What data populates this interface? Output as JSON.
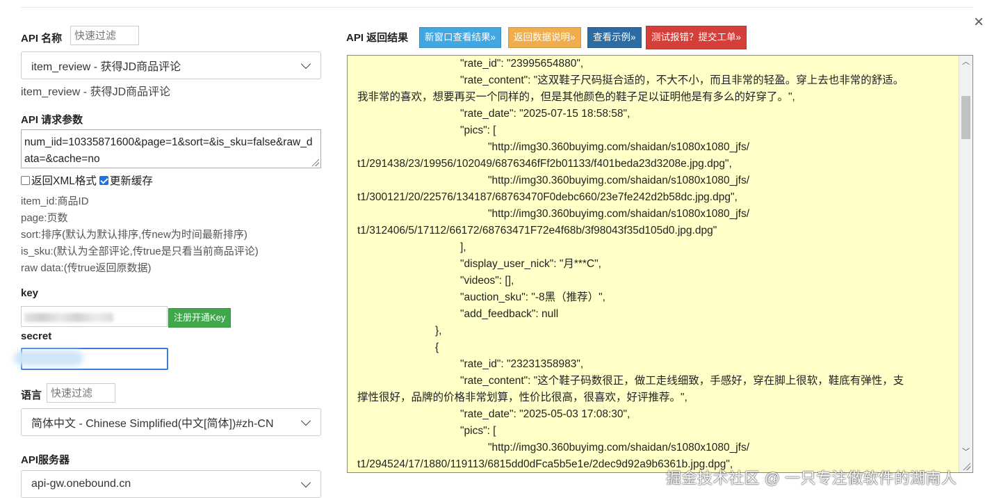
{
  "dialog": {
    "close_label": "×"
  },
  "left": {
    "api_name_label": "API 名称",
    "api_name_filter_placeholder": "快速过滤",
    "api_select_value": "item_review - 获得JD商品评论",
    "api_selected_text": "item_review - 获得JD商品评论",
    "params_label": "API 请求参数",
    "params_value": "num_iid=10335871600&page=1&sort=&is_sku=false&raw_data=&cache=no",
    "xml_checkbox_label": "返回XML格式",
    "xml_checked": false,
    "cache_checkbox_label": "更新缓存",
    "cache_checked": true,
    "descriptions": [
      "item_id:商品ID",
      "page:页数",
      "sort:排序(默认为默认排序,传new为时间最新排序)",
      "is_sku:(默认为全部评论,传true是只看当前商品评论)",
      "raw data:(传true返回原数据)"
    ],
    "key_label": "key",
    "register_key_button": "注册开通Key",
    "secret_label": "secret",
    "lang_label": "语言",
    "lang_filter_placeholder": "快速过滤",
    "lang_select_value": "简体中文 - Chinese Simplified(中文[简体])#zh-CN",
    "server_label": "API服务器",
    "server_select_value": "api-gw.onebound.cn"
  },
  "right": {
    "title": "API 返回结果",
    "buttons": [
      {
        "label": "新窗口查看结果»",
        "color": "#41a7e1"
      },
      {
        "label": "返回数据说明»",
        "color": "#f0ad4e"
      },
      {
        "label": "查看示例»",
        "color": "#2d6ca2"
      },
      {
        "label": "测试报错？提交工单»",
        "color": "#d43f3a"
      }
    ],
    "result_lines": [
      {
        "indent": 2,
        "text": "\"rate_id\": \"23995654880\","
      },
      {
        "indent": 2,
        "text": "\"rate_content\": \"这双鞋子尺码挺合适的，不大不小，而且非常的轻盈。穿上去也非常的舒适。"
      },
      {
        "indent": 0,
        "text": "我非常的喜欢，想要再买一个同样的，但是其他颜色的鞋子足以证明他是有多么的好穿了。\","
      },
      {
        "indent": 2,
        "text": "\"rate_date\": \"2025-07-15 18:58:58\","
      },
      {
        "indent": 2,
        "text": "\"pics\": ["
      },
      {
        "indent": 3,
        "text": "\"http://img30.360buyimg.com/shaidan/s1080x1080_jfs/"
      },
      {
        "indent": 0,
        "text": "t1/291438/23/19956/102049/6876346fFf2b01133/f401beda23d3208e.jpg.dpg\","
      },
      {
        "indent": 3,
        "text": "\"http://img30.360buyimg.com/shaidan/s1080x1080_jfs/"
      },
      {
        "indent": 0,
        "text": "t1/300121/20/22576/134187/68763470F0debc660/23e7fe242d2b58dc.jpg.dpg\","
      },
      {
        "indent": 3,
        "text": "\"http://img30.360buyimg.com/shaidan/s1080x1080_jfs/"
      },
      {
        "indent": 0,
        "text": "t1/312406/5/17112/66172/68763471F72e4f68b/3f98043f35d105d0.jpg.dpg\""
      },
      {
        "indent": 2,
        "text": "],"
      },
      {
        "indent": 2,
        "text": "\"display_user_nick\": \"月***C\","
      },
      {
        "indent": 2,
        "text": "\"videos\": [],"
      },
      {
        "indent": 2,
        "text": "\"auction_sku\": \"-8黑（推荐）\","
      },
      {
        "indent": 2,
        "text": "\"add_feedback\": null"
      },
      {
        "indent": 1,
        "text": "},"
      },
      {
        "indent": 1,
        "text": "{"
      },
      {
        "indent": 2,
        "text": "\"rate_id\": \"23231358983\","
      },
      {
        "indent": 2,
        "text": "\"rate_content\": \"这个鞋子码数很正，做工走线细致，手感好，穿在脚上很软，鞋底有弹性，支"
      },
      {
        "indent": 0,
        "text": "撑性很好，品牌的价格非常划算，性价比很高，很喜欢，好评推荐。\","
      },
      {
        "indent": 2,
        "text": "\"rate_date\": \"2025-05-03 17:08:30\","
      },
      {
        "indent": 2,
        "text": "\"pics\": ["
      },
      {
        "indent": 3,
        "text": "\"http://img30.360buyimg.com/shaidan/s1080x1080_jfs/"
      },
      {
        "indent": 0,
        "text": "t1/294524/17/1880/119113/6815dd0dFca5b5e1e/2dec9d92a9b6361b.jpg.dpg\","
      }
    ]
  },
  "watermark": "掘金技术社区 @ 一只专注做软件的湖南人"
}
